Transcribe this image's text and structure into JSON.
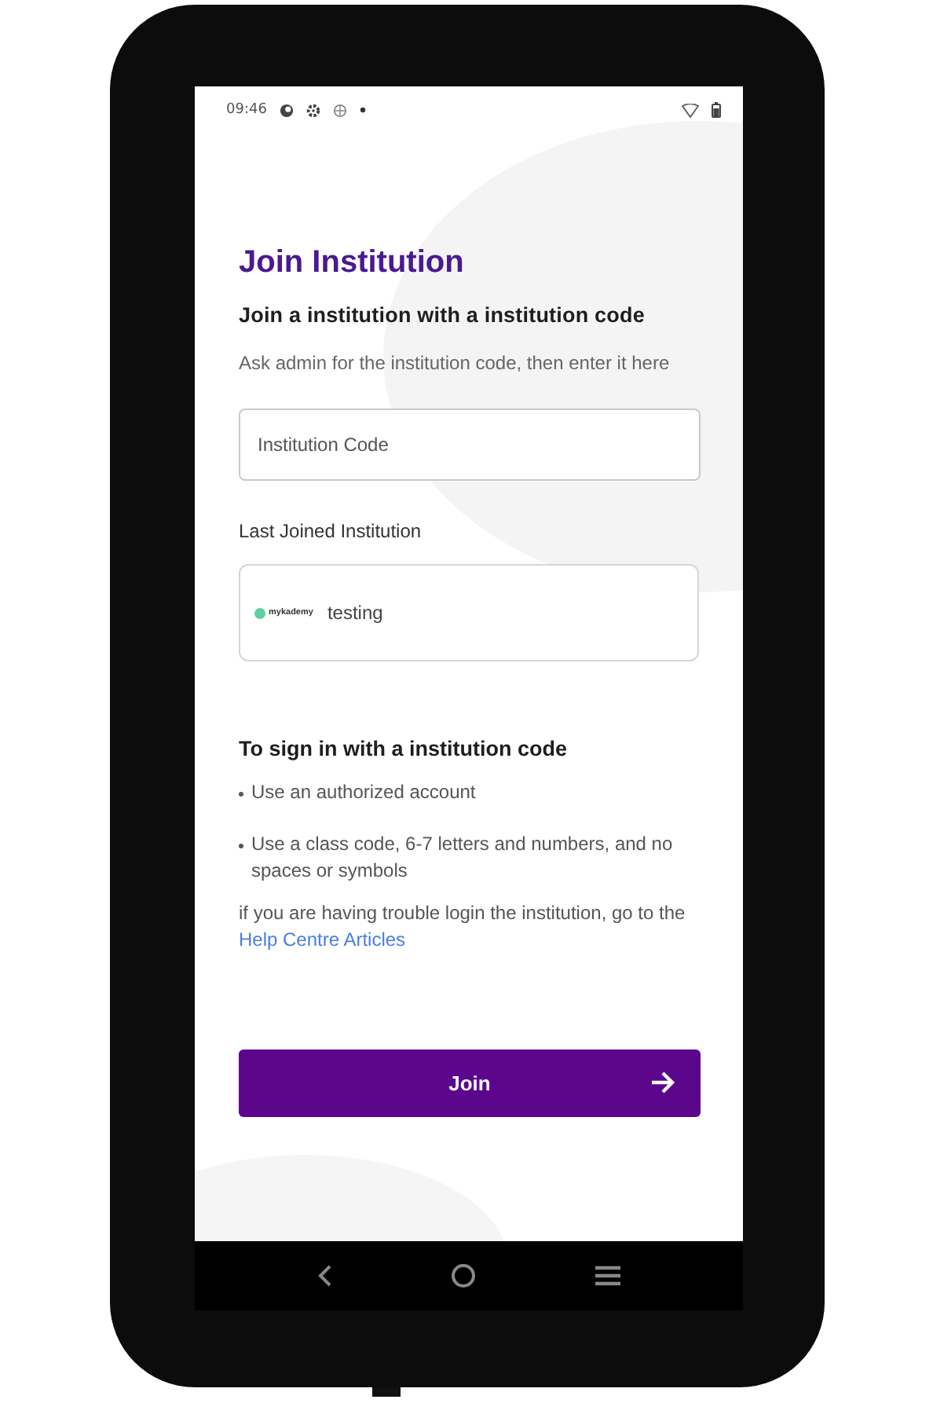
{
  "status_bar": {
    "time": "09:46"
  },
  "title": "Join Institution",
  "subtitle": "Join a institution with a institution code",
  "hint": "Ask admin for the institution code, then enter it here",
  "code_field": {
    "placeholder": "Institution Code"
  },
  "last_joined": {
    "label": "Last Joined Institution",
    "logo_text": "mykademy",
    "name": "testing"
  },
  "instructions": {
    "heading": "To sign in with a institution code",
    "bullets": [
      "Use an authorized account",
      "Use a class code, 6-7 letters and numbers, and no spaces or symbols"
    ],
    "help_text": "if you are having trouble login the institution, go to the ",
    "help_link": "Help Centre Articles"
  },
  "join_button": {
    "label": "Join"
  }
}
